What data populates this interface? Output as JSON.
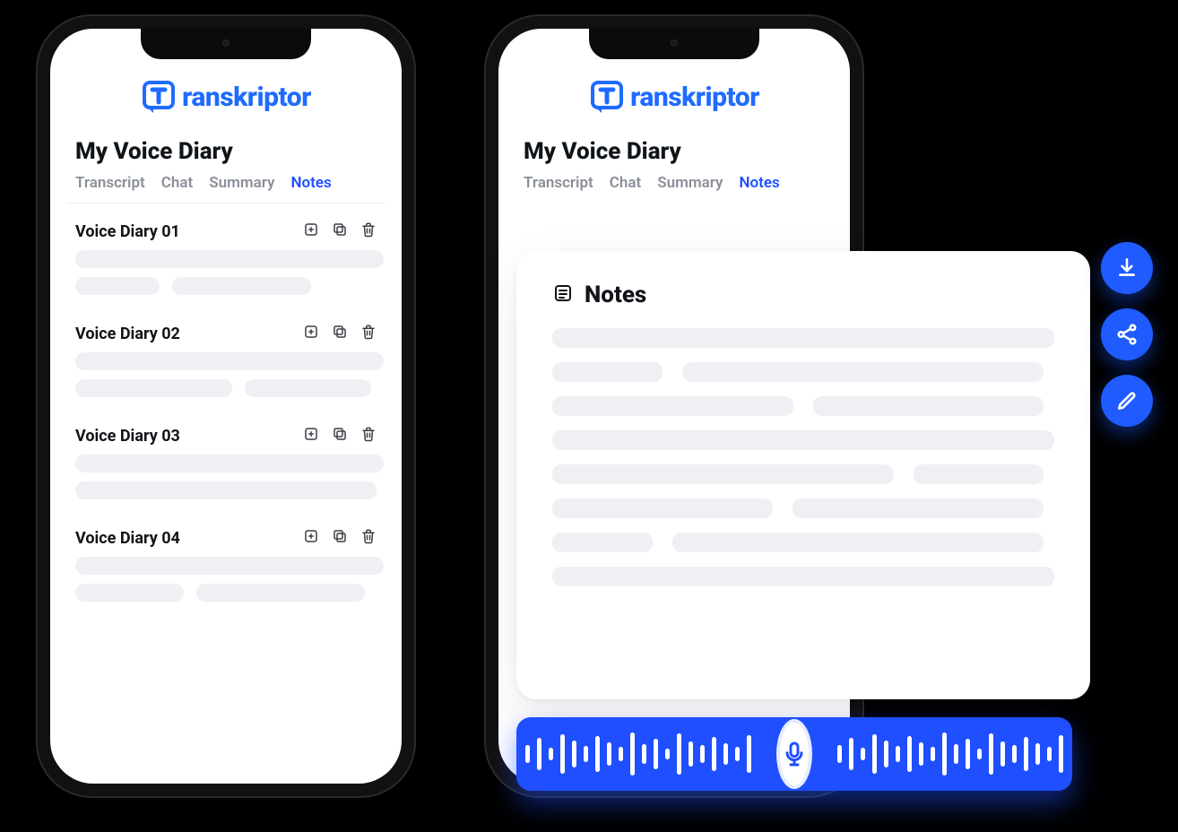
{
  "brand": {
    "name": "Transkriptor",
    "text": "ranskriptor"
  },
  "page": {
    "title": "My Voice Diary"
  },
  "tabs": {
    "items": [
      "Transcript",
      "Chat",
      "Summary",
      "Notes"
    ],
    "active": "Notes"
  },
  "diary": {
    "items": [
      {
        "title": "Voice Diary 01"
      },
      {
        "title": "Voice Diary 02"
      },
      {
        "title": "Voice Diary 03"
      },
      {
        "title": "Voice Diary 04"
      }
    ]
  },
  "notes": {
    "title": "Notes"
  },
  "actions": {
    "download": "download",
    "share": "share",
    "edit": "edit"
  },
  "colors": {
    "accent": "#1f5bff",
    "skeleton": "#eef0f3"
  }
}
